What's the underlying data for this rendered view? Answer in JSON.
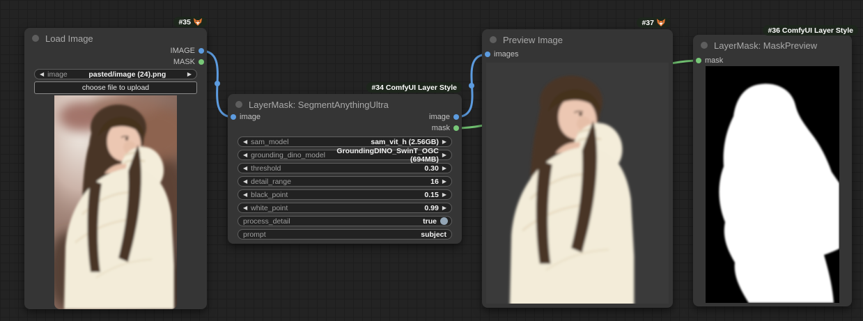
{
  "app": {
    "name": "ComfyUI node graph"
  },
  "colors": {
    "canvas_bg": "#232323",
    "node_bg": "#353535",
    "image_port": "#5d9ce0",
    "mask_port": "#78c878",
    "badge_bg": "#1d261c",
    "preview_bg": "#3a3a3a",
    "mask_black": "#000000",
    "mask_white": "#ffffff"
  },
  "nodes": {
    "load_image": {
      "badge": "#35",
      "badge_icon": "fox-icon",
      "title": "Load Image",
      "outputs": [
        {
          "name": "IMAGE",
          "type": "image"
        },
        {
          "name": "MASK",
          "type": "mask"
        }
      ],
      "widgets": [
        {
          "kind": "combo",
          "label": "image",
          "value": "pasted/image (24).png"
        }
      ],
      "upload_button": "choose file to upload"
    },
    "segment": {
      "badge": "#34 ComfyUI Layer Style",
      "title": "LayerMask: SegmentAnythingUltra",
      "inputs": [
        {
          "name": "image",
          "type": "image"
        }
      ],
      "outputs": [
        {
          "name": "image",
          "type": "image"
        },
        {
          "name": "mask",
          "type": "mask"
        }
      ],
      "widgets": [
        {
          "kind": "combo",
          "label": "sam_model",
          "value": "sam_vit_h (2.56GB)"
        },
        {
          "kind": "combo",
          "label": "grounding_dino_model",
          "value": "GroundingDINO_SwinT_OGC (694MB)"
        },
        {
          "kind": "number",
          "label": "threshold",
          "value": "0.30"
        },
        {
          "kind": "number",
          "label": "detail_range",
          "value": "16"
        },
        {
          "kind": "number",
          "label": "black_point",
          "value": "0.15"
        },
        {
          "kind": "number",
          "label": "white_point",
          "value": "0.99"
        },
        {
          "kind": "toggle",
          "label": "process_detail",
          "value": "true"
        },
        {
          "kind": "text",
          "label": "prompt",
          "value": "subject"
        }
      ]
    },
    "preview_image": {
      "badge": "#37",
      "badge_icon": "fox-icon",
      "title": "Preview Image",
      "inputs": [
        {
          "name": "images",
          "type": "image"
        }
      ]
    },
    "mask_preview": {
      "badge": "#36 ComfyUI Layer Style",
      "title": "LayerMask: MaskPreview",
      "inputs": [
        {
          "name": "mask",
          "type": "mask"
        }
      ]
    }
  },
  "links": [
    {
      "from": "load_image.IMAGE",
      "to": "segment.image",
      "type": "image"
    },
    {
      "from": "segment.image",
      "to": "preview_image.images",
      "type": "image"
    },
    {
      "from": "segment.mask",
      "to": "mask_preview.mask",
      "type": "mask"
    }
  ]
}
